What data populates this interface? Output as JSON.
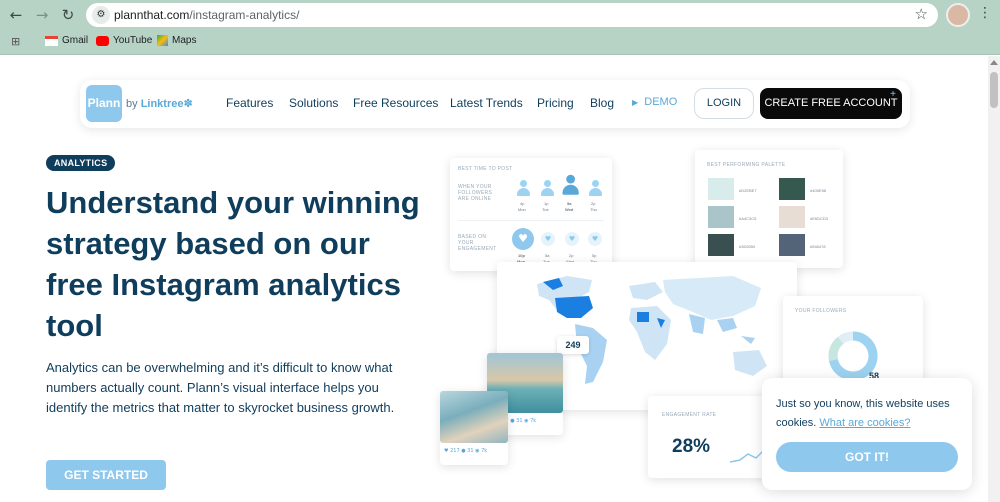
{
  "browser": {
    "url_domain": "plannthat.com",
    "url_path": "/instagram-analytics/",
    "bookmarks": [
      "Gmail",
      "YouTube",
      "Maps"
    ]
  },
  "nav": {
    "logo": "Plann",
    "by": "by",
    "linktree": "Linktree",
    "links": [
      "Features",
      "Solutions",
      "Free Resources",
      "Latest Trends",
      "Pricing",
      "Blog"
    ],
    "demo": "DEMO",
    "login": "LOGIN",
    "create": "CREATE FREE ACCOUNT"
  },
  "hero": {
    "badge": "ANALYTICS",
    "title": "Understand your winning strategy based on our free Instagram analytics tool",
    "description": "Analytics can be overwhelming and it’s difficult to know what numbers actually count. Plann’s visual interface helps you  identify the metrics that matter to skyrocket business growth.",
    "cta": "GET STARTED"
  },
  "cards": {
    "best_time": {
      "label": "BEST TIME TO POST",
      "followers_label": "WHEN YOUR FOLLOWERS ARE ONLINE",
      "engagement_label": "BASED ON YOUR ENGAGEMENT",
      "top_times": [
        "4p",
        "1p",
        "5a",
        "2p"
      ],
      "top_days": [
        "Mon",
        "Tue",
        "Wed",
        "Thu"
      ],
      "bottom_times": [
        "10p",
        "5a",
        "2p",
        "5p"
      ],
      "bottom_days": [
        "Mon",
        "Tue",
        "Wed",
        "Thu"
      ]
    },
    "palette": {
      "label": "BEST PERFORMING PALETTE",
      "swatches": [
        {
          "color": "#d8ecec",
          "hex": "#D2EBE7"
        },
        {
          "color": "#35594f",
          "hex": "#405E58"
        },
        {
          "color": "#a9c5c9",
          "hex": "#A4C3C5"
        },
        {
          "color": "#e8ddd4",
          "hex": "#E6DCD3"
        },
        {
          "color": "#3a5050",
          "hex": "#3D5050"
        },
        {
          "color": "#546478",
          "hex": "#546478"
        }
      ]
    },
    "map": {
      "value": "249"
    },
    "followers": {
      "label": "YOUR FOLLOWERS",
      "value": "58"
    },
    "engagement": {
      "label": "ENGAGEMENT RATE",
      "value": "28%"
    },
    "photos": [
      {
        "likes": "217",
        "comments": "31",
        "views": "7k"
      },
      {
        "likes": "217",
        "comments": "31",
        "views": "7k"
      }
    ]
  },
  "cookie": {
    "text": "Just so you know, this website uses cookies.",
    "link": "What are cookies?",
    "button": "GOT IT!"
  }
}
